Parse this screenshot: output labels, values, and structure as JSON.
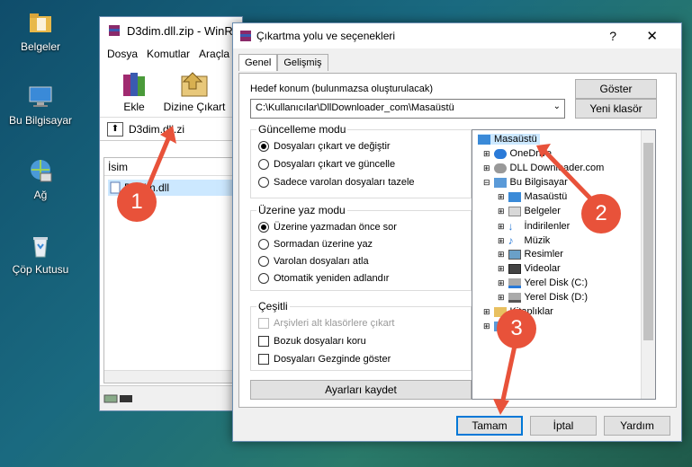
{
  "desktop": {
    "icons": [
      {
        "label": "Belgeler"
      },
      {
        "label": "Bu Bilgisayar"
      },
      {
        "label": "Ağ"
      },
      {
        "label": "Çöp Kutusu"
      }
    ]
  },
  "winrar": {
    "title": "D3dim.dll.zip - WinR",
    "menu": [
      "Dosya",
      "Komutlar",
      "Araçla"
    ],
    "toolbar": {
      "extract_label": "Ekle",
      "extract_to_label": "Dizine Çıkart"
    },
    "path": "D3dim.dll.zi",
    "list_header": "İsim",
    "file_name": "D3dim.dll"
  },
  "dialog": {
    "title": "Çıkartma yolu ve seçenekleri",
    "help_symbol": "?",
    "close_symbol": "✕",
    "tabs": [
      "Genel",
      "Gelişmiş"
    ],
    "dest_label": "Hedef konum (bulunmazsa oluşturulacak)",
    "dest_value": "C:\\Kullanıcılar\\DllDownloader_com\\Masaüstü",
    "show_button": "Göster",
    "new_folder_button": "Yeni klasör",
    "update_mode": {
      "label": "Güncelleme modu",
      "options": [
        "Dosyaları çıkart ve değiştir",
        "Dosyaları çıkart ve güncelle",
        "Sadece varolan dosyaları tazele"
      ]
    },
    "overwrite_mode": {
      "label": "Üzerine yaz modu",
      "options": [
        "Üzerine yazmadan önce sor",
        "Sormadan üzerine yaz",
        "Varolan dosyaları atla",
        "Otomatik yeniden adlandır"
      ]
    },
    "misc": {
      "label": "Çeşitli",
      "options": [
        "Arşivleri alt klasörlere çıkart",
        "Bozuk dosyaları koru",
        "Dosyaları Gezginde göster"
      ]
    },
    "save_settings_button": "Ayarları kaydet",
    "tree": [
      "Masaüstü",
      "OneDrive",
      "DLL Downloader.com",
      "Bu Bilgisayar",
      "Masaüstü",
      "Belgeler",
      "İndirilenler",
      "Müzik",
      "Resimler",
      "Videolar",
      "Yerel Disk (C:)",
      "Yerel Disk (D:)",
      "Kitaplıklar",
      "Ağ"
    ],
    "ok_button": "Tamam",
    "cancel_button": "İptal",
    "help_button": "Yardım"
  },
  "annotations": {
    "step1": "1",
    "step2": "2",
    "step3": "3"
  },
  "colors": {
    "badge": "#e8523a",
    "selection": "#cce8ff",
    "accent": "#0078d7"
  }
}
